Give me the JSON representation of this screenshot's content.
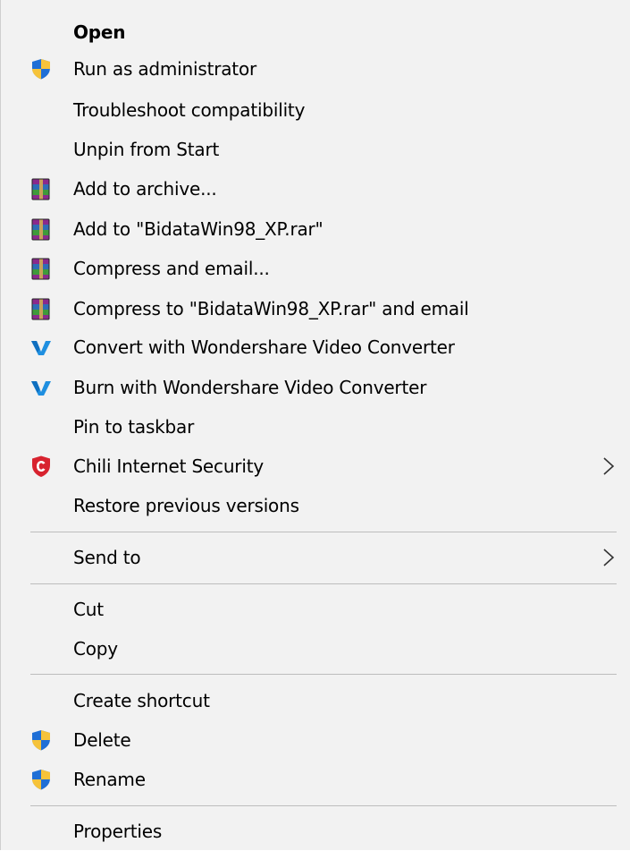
{
  "menu": {
    "items": [
      {
        "label": "Open",
        "icon": "none"
      },
      {
        "label": "Run as administrator",
        "icon": "uac-shield-icon"
      },
      {
        "label": "Troubleshoot compatibility",
        "icon": "none"
      },
      {
        "label": "Unpin from Start",
        "icon": "none"
      },
      {
        "label": "Add to archive...",
        "icon": "winrar-icon"
      },
      {
        "label": "Add to \"BidataWin98_XP.rar\"",
        "icon": "winrar-icon"
      },
      {
        "label": "Compress and email...",
        "icon": "winrar-icon"
      },
      {
        "label": "Compress to \"BidataWin98_XP.rar\" and email",
        "icon": "winrar-icon"
      },
      {
        "label": "Convert with Wondershare Video Converter",
        "icon": "wondershare-icon"
      },
      {
        "label": "Burn with Wondershare Video Converter",
        "icon": "wondershare-icon"
      },
      {
        "label": "Pin to taskbar",
        "icon": "none"
      },
      {
        "label": "Chili Internet Security",
        "icon": "chili-shield-icon",
        "submenu": true
      },
      {
        "label": "Restore previous versions",
        "icon": "none"
      },
      {
        "label": "Send to",
        "icon": "none",
        "submenu": true
      },
      {
        "label": "Cut",
        "icon": "none"
      },
      {
        "label": "Copy",
        "icon": "none"
      },
      {
        "label": "Create shortcut",
        "icon": "none"
      },
      {
        "label": "Delete",
        "icon": "uac-shield-icon"
      },
      {
        "label": "Rename",
        "icon": "uac-shield-icon"
      },
      {
        "label": "Properties",
        "icon": "none"
      }
    ]
  },
  "colors": {
    "background": "#f2f2f2",
    "separator": "#bdbdbd",
    "wondershare_blue": "#1f8fe0",
    "chili_red": "#d8232f",
    "uac_blue": "#1f6fd6",
    "uac_yellow": "#f6c33a"
  }
}
